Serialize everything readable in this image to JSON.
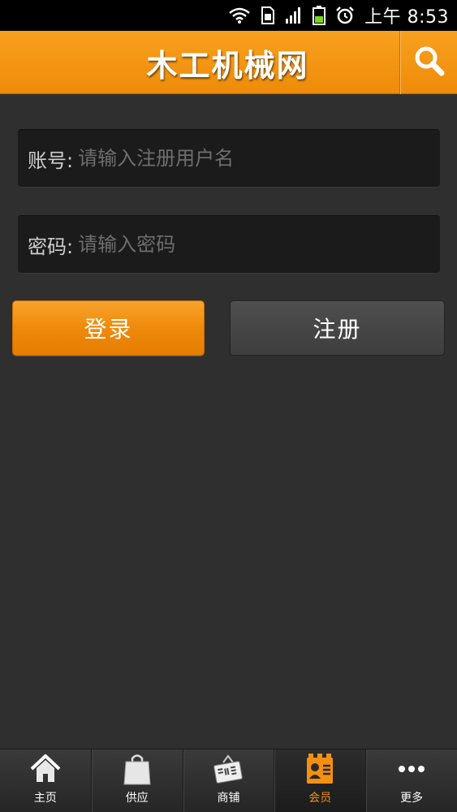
{
  "status_bar": {
    "time": "上午 8:53",
    "icons": [
      "wifi-icon",
      "sim-icon",
      "signal-icon",
      "battery-icon",
      "alarm-icon"
    ]
  },
  "header": {
    "title": "木工机械网",
    "search_icon": "search-icon"
  },
  "login_form": {
    "account_label": "账号:",
    "account_placeholder": "请输入注册用户名",
    "account_value": "",
    "password_label": "密码:",
    "password_placeholder": "请输入密码",
    "password_value": "",
    "login_label": "登录",
    "register_label": "注册"
  },
  "tab_bar": {
    "items": [
      {
        "label": "主页",
        "icon": "home-icon"
      },
      {
        "label": "供应",
        "icon": "shopping-bag-icon"
      },
      {
        "label": "商铺",
        "icon": "shop-open-sign-icon"
      },
      {
        "label": "会员",
        "icon": "member-card-icon",
        "active": true
      },
      {
        "label": "更多",
        "icon": "more-dots-icon"
      }
    ]
  },
  "colors": {
    "accent": "#f39011",
    "background": "#2f2f2f",
    "field_background": "#1b1b1b"
  }
}
